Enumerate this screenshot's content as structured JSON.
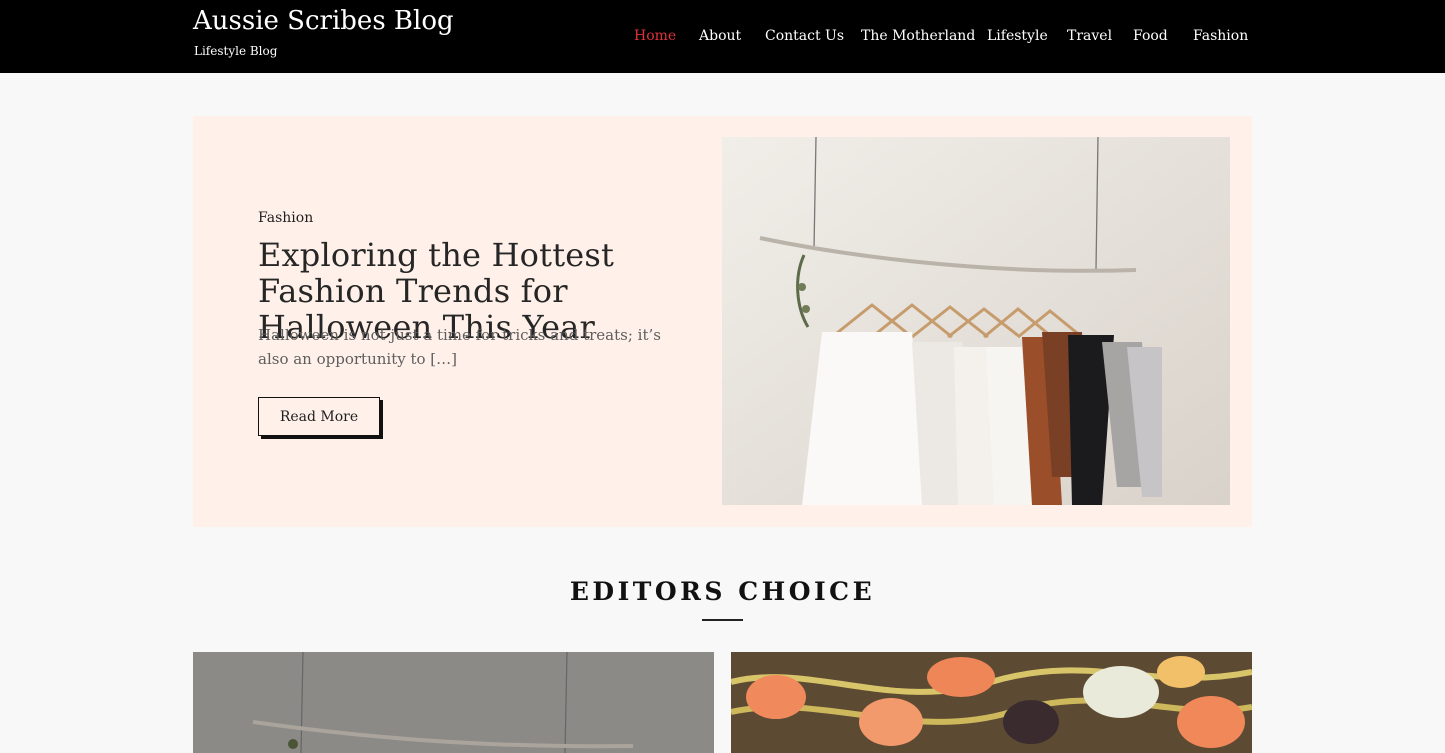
{
  "header": {
    "title": "Aussie Scribes Blog",
    "tagline": "Lifestyle Blog"
  },
  "nav": {
    "items": [
      {
        "label": "Home",
        "active": true
      },
      {
        "label": "About",
        "active": false
      },
      {
        "label": "Contact Us",
        "active": false
      },
      {
        "label": "The Motherland",
        "active": false
      },
      {
        "label": "Lifestyle",
        "active": false
      },
      {
        "label": "Travel",
        "active": false
      },
      {
        "label": "Food",
        "active": false
      },
      {
        "label": "Fashion",
        "active": false
      }
    ]
  },
  "hero": {
    "category": "Fashion",
    "title": "Exploring the Hottest Fashion Trends for Halloween This Year",
    "excerpt": "Halloween is not just a time for tricks and treats; it’s also an opportunity to […]",
    "read_more_label": "Read More",
    "image_icon": "clothes-rack-photo"
  },
  "editors_choice": {
    "heading": "EDITORS CHOICE",
    "cards": [
      {
        "image_icon": "clothes-rack-photo"
      },
      {
        "image_icon": "shrimp-noodles-photo"
      }
    ]
  },
  "colors": {
    "header_bg": "#000000",
    "accent": "#e0323c",
    "hero_bg": "#fff1ea",
    "page_bg": "#f8f8f8"
  }
}
